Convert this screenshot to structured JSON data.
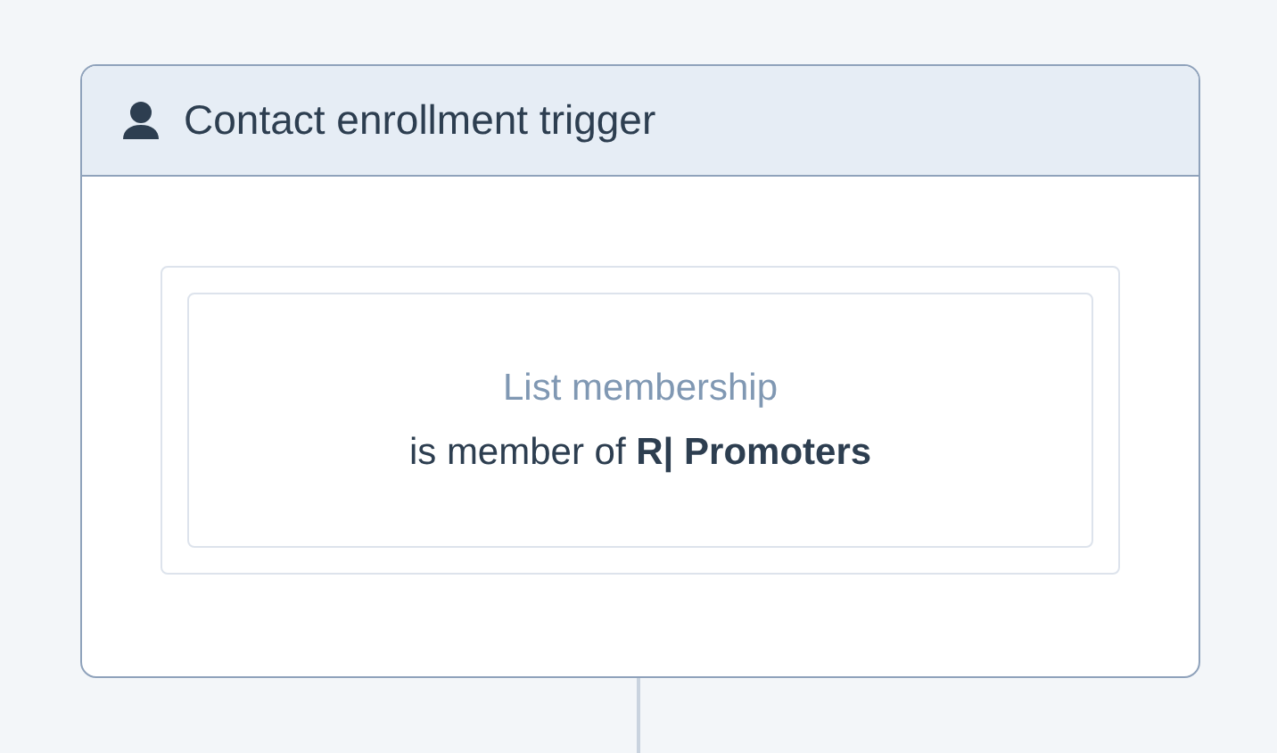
{
  "card": {
    "title": "Contact enrollment trigger"
  },
  "filter": {
    "category": "List membership",
    "condition": "is member of **R| Promoters**"
  }
}
